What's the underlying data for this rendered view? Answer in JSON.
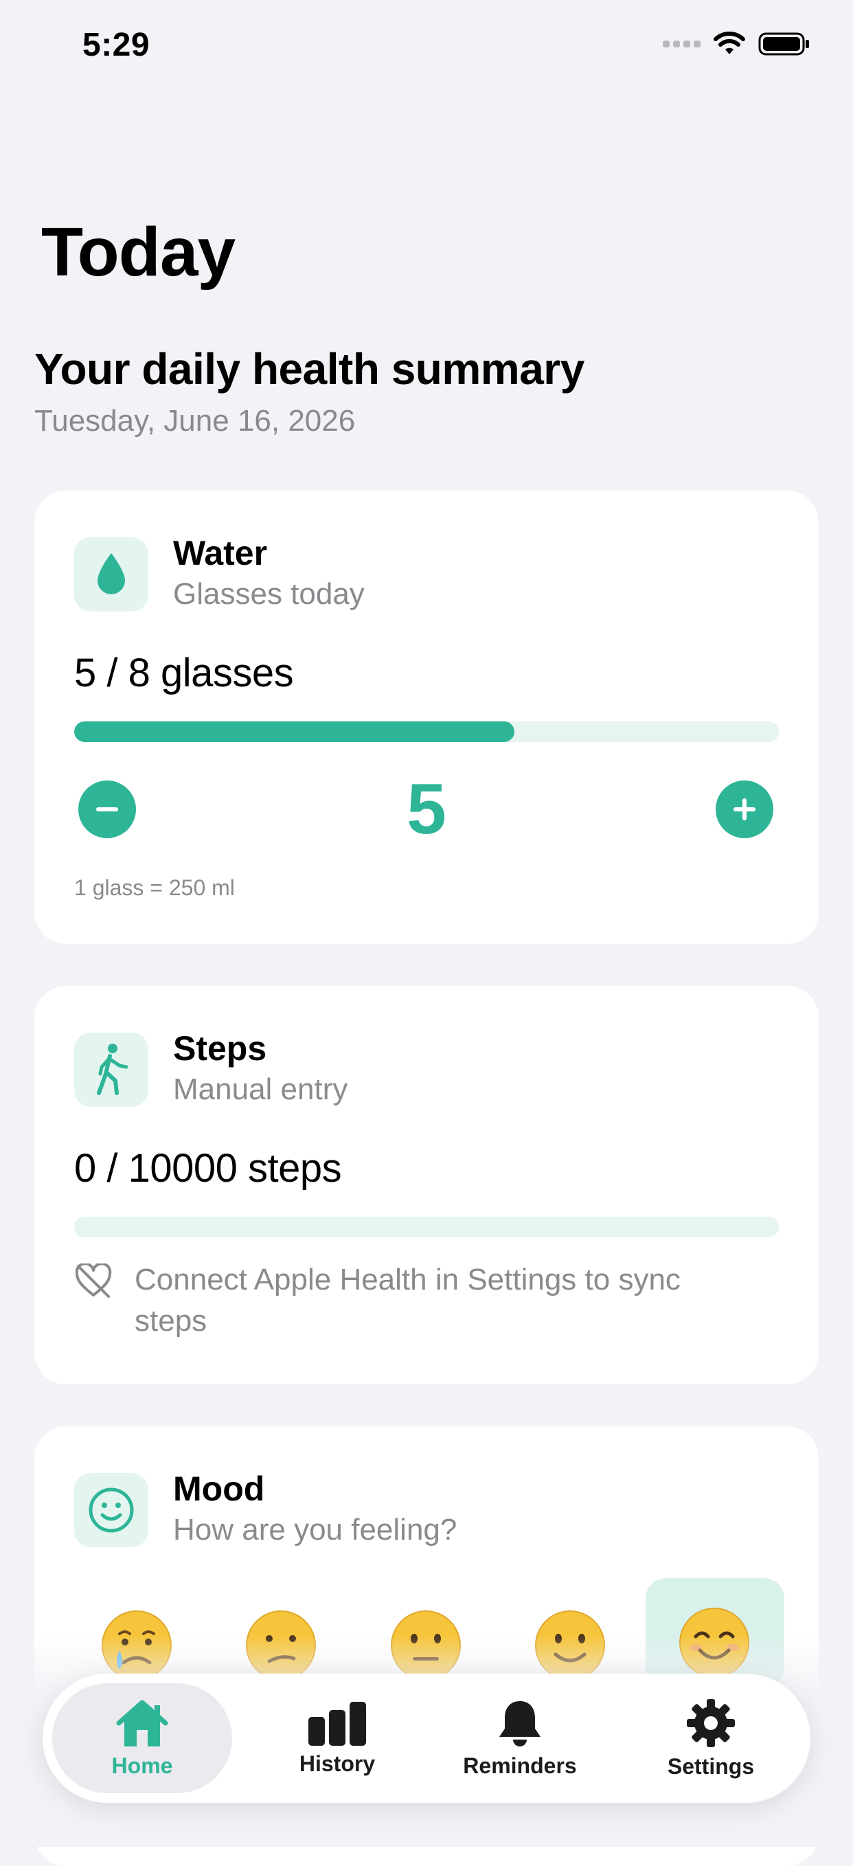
{
  "status_bar": {
    "time": "5:29"
  },
  "header": {
    "title": "Today",
    "summary_heading": "Your daily health summary",
    "date": "Tuesday, June 16, 2026"
  },
  "water": {
    "icon": "water-drop-icon",
    "title": "Water",
    "subtitle": "Glasses today",
    "value_text": "5 / 8 glasses",
    "progress": 0.625,
    "count": "5",
    "note": "1 glass = 250 ml"
  },
  "steps": {
    "icon": "walking-figure-icon",
    "title": "Steps",
    "subtitle": "Manual entry",
    "value_text": "0 / 10000 steps",
    "progress": 0,
    "health_note": "Connect Apple Health in Settings to sync steps"
  },
  "mood": {
    "icon": "smiley-icon",
    "title": "Mood",
    "subtitle": "How are you feeling?",
    "options": [
      "crying-face",
      "confused-face",
      "neutral-face",
      "slightly-smiling-face",
      "smiling-face"
    ],
    "selected_index": 4
  },
  "tabbar": {
    "tabs": [
      {
        "label": "Home",
        "icon": "house-icon",
        "active": true
      },
      {
        "label": "History",
        "icon": "bar-chart-icon",
        "active": false
      },
      {
        "label": "Reminders",
        "icon": "bell-icon",
        "active": false
      },
      {
        "label": "Settings",
        "icon": "gear-icon",
        "active": false
      }
    ]
  },
  "colors": {
    "accent": "#2EB597",
    "accent_light": "#E4F5F0",
    "background": "#F2F2F7"
  }
}
